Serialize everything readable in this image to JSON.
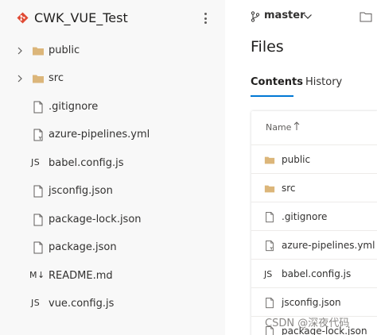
{
  "repo": {
    "name": "CWK_VUE_Test",
    "icon": "git-repo-icon",
    "brand_color": "#e04b35"
  },
  "tree": {
    "items": [
      {
        "type": "folder",
        "label": "public",
        "expandable": true
      },
      {
        "type": "folder",
        "label": "src",
        "expandable": true
      },
      {
        "type": "file",
        "label": ".gitignore",
        "icon": "file-icon"
      },
      {
        "type": "file",
        "label": "azure-pipelines.yml",
        "icon": "yaml-file-icon"
      },
      {
        "type": "js",
        "label": "babel.config.js",
        "icon_text": "JS"
      },
      {
        "type": "file",
        "label": "jsconfig.json",
        "icon": "file-icon"
      },
      {
        "type": "file",
        "label": "package-lock.json",
        "icon": "file-icon"
      },
      {
        "type": "file",
        "label": "package.json",
        "icon": "file-icon"
      },
      {
        "type": "md",
        "label": "README.md",
        "icon_text": "M↓"
      },
      {
        "type": "js",
        "label": "vue.config.js",
        "icon_text": "JS"
      }
    ]
  },
  "branch": {
    "name": "master",
    "icon": "branch-icon"
  },
  "files": {
    "title": "Files",
    "tabs": [
      {
        "label": "Contents",
        "active": true
      },
      {
        "label": "History",
        "active": false
      }
    ],
    "column_header": "Name",
    "sort_icon": "arrow-up-icon",
    "rows": [
      {
        "type": "folder",
        "label": "public"
      },
      {
        "type": "folder",
        "label": "src"
      },
      {
        "type": "file",
        "label": ".gitignore"
      },
      {
        "type": "file",
        "label": "azure-pipelines.yml"
      },
      {
        "type": "js",
        "label": "babel.config.js",
        "icon_text": "JS"
      },
      {
        "type": "file",
        "label": "jsconfig.json"
      },
      {
        "type": "file",
        "label": "package-lock.json"
      }
    ]
  },
  "watermark": "CSDN @深夜代码",
  "colors": {
    "accent": "#0078d4",
    "folder": "#dcb67a"
  }
}
